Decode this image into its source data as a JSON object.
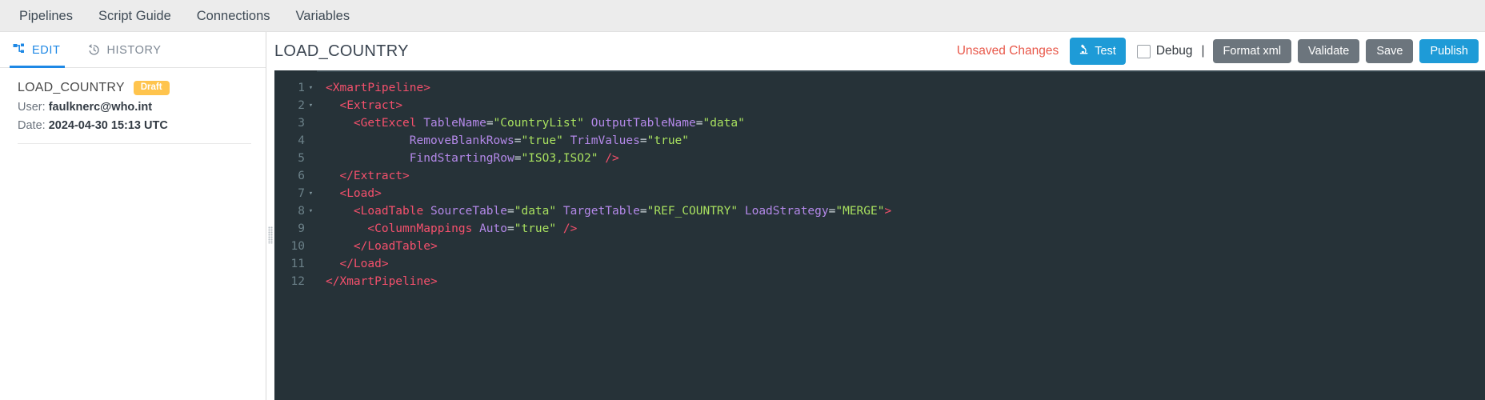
{
  "top_nav": {
    "items": [
      {
        "label": "Pipelines"
      },
      {
        "label": "Script Guide"
      },
      {
        "label": "Connections"
      },
      {
        "label": "Variables"
      }
    ]
  },
  "sidebar": {
    "tabs": [
      {
        "label": "EDIT",
        "icon": "pipeline-icon",
        "active": true
      },
      {
        "label": "HISTORY",
        "icon": "history-clock-icon",
        "active": false
      }
    ],
    "pipeline": {
      "name": "LOAD_COUNTRY",
      "badge": "Draft",
      "user_label": "User:",
      "user_value": "faulknerc@who.int",
      "date_label": "Date:",
      "date_value": "2024-04-30 15:13 UTC"
    }
  },
  "main": {
    "title": "LOAD_COUNTRY",
    "status": "Unsaved Changes",
    "buttons": {
      "test": "Test",
      "debug_label": "Debug",
      "debug_separator": "|",
      "format_xml": "Format xml",
      "validate": "Validate",
      "save": "Save",
      "publish": "Publish"
    },
    "debug_checked": false
  },
  "editor": {
    "language": "xml",
    "line_numbers": [
      1,
      2,
      3,
      4,
      5,
      6,
      7,
      8,
      9,
      10,
      11,
      12
    ],
    "foldable_lines": [
      1,
      2,
      7,
      8
    ],
    "lines": [
      {
        "n": 1,
        "indent": 0,
        "text": "<XmartPipeline>"
      },
      {
        "n": 2,
        "indent": 1,
        "text": "<Extract>"
      },
      {
        "n": 3,
        "indent": 2,
        "text": "<GetExcel TableName=\"CountryList\" OutputTableName=\"data\""
      },
      {
        "n": 4,
        "indent": 0,
        "text": "            RemoveBlankRows=\"true\" TrimValues=\"true\""
      },
      {
        "n": 5,
        "indent": 0,
        "text": "            FindStartingRow=\"ISO3,ISO2\" />"
      },
      {
        "n": 6,
        "indent": 1,
        "text": "</Extract>"
      },
      {
        "n": 7,
        "indent": 1,
        "text": "<Load>"
      },
      {
        "n": 8,
        "indent": 2,
        "text": "<LoadTable SourceTable=\"data\" TargetTable=\"REF_COUNTRY\" LoadStrategy=\"MERGE\">"
      },
      {
        "n": 9,
        "indent": 3,
        "text": "<ColumnMappings Auto=\"true\" />"
      },
      {
        "n": 10,
        "indent": 2,
        "text": "</LoadTable>"
      },
      {
        "n": 11,
        "indent": 1,
        "text": "</Load>"
      },
      {
        "n": 12,
        "indent": 0,
        "text": "</XmartPipeline>"
      }
    ]
  },
  "colors": {
    "accent_blue": "#1e88e5",
    "button_blue": "#1e9bd7",
    "button_grey": "#6c757d",
    "badge_amber": "#ffc44d",
    "unsaved_red": "#e8584a",
    "editor_bg": "#263238",
    "code_tag": "#f4506c",
    "code_attr": "#b388e8",
    "code_string": "#a8e05f"
  }
}
